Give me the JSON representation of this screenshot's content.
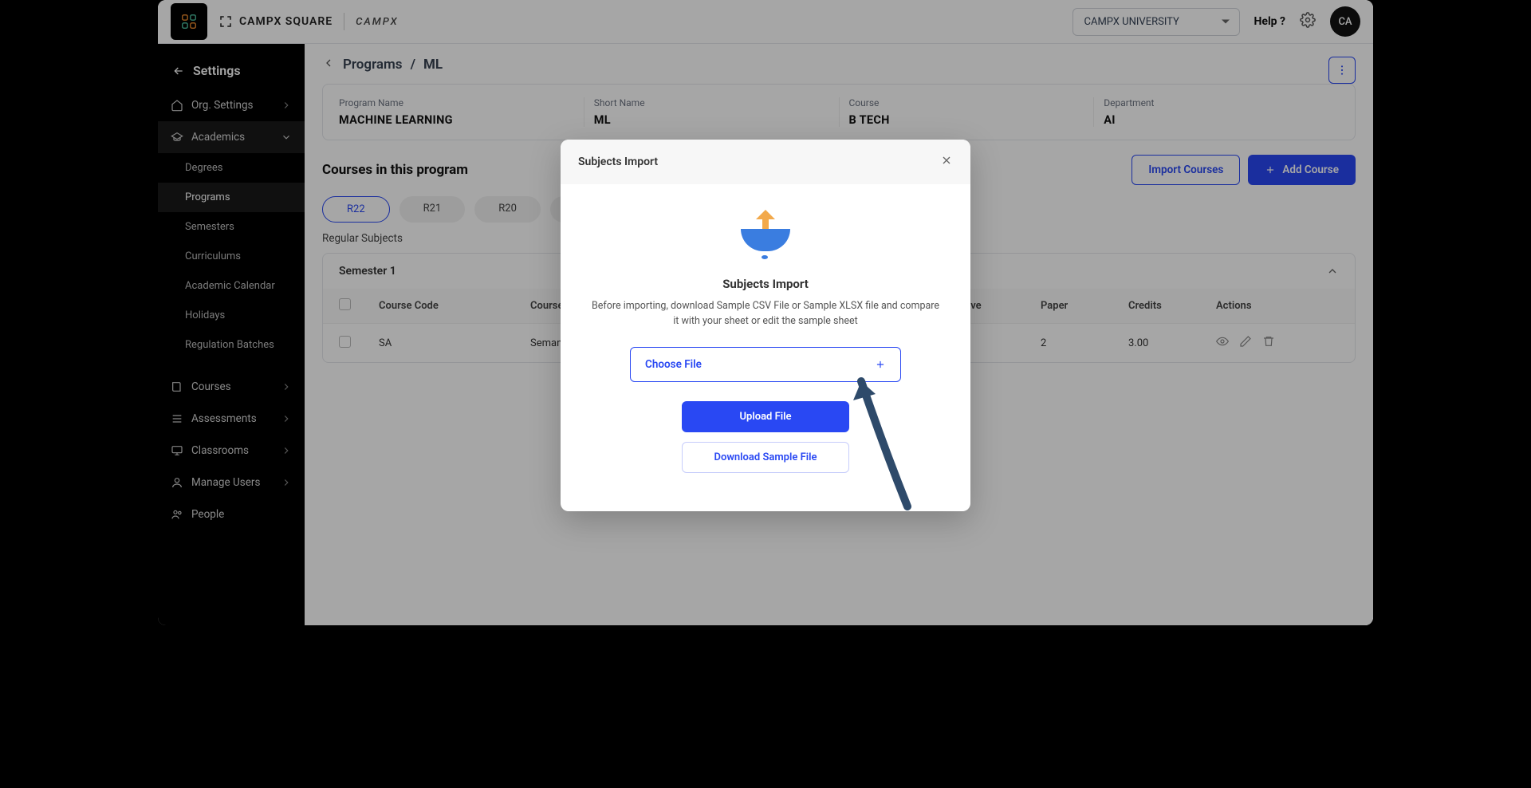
{
  "topbar": {
    "brand_square": "CAMPX SQUARE",
    "brand_x": "CAMPX",
    "university": "CAMPX UNIVERSITY",
    "help": "Help ?",
    "avatar": "CA"
  },
  "sidebar": {
    "header": "Settings",
    "groups": [
      {
        "label": "Org. Settings",
        "expandable": true
      },
      {
        "label": "Academics",
        "expandable": true,
        "expanded": true,
        "subs": [
          "Degrees",
          "Programs",
          "Semesters",
          "Curriculums",
          "Academic Calendar",
          "Holidays",
          "Regulation Batches"
        ],
        "active_sub": "Programs"
      },
      {
        "label": "Courses",
        "expandable": true
      },
      {
        "label": "Assessments",
        "expandable": true
      },
      {
        "label": "Classrooms",
        "expandable": true
      },
      {
        "label": "Manage Users",
        "expandable": true
      },
      {
        "label": "People",
        "expandable": false
      }
    ]
  },
  "crumbs": {
    "root": "Programs",
    "sep": "/",
    "current": "ML"
  },
  "details": [
    {
      "label": "Program Name",
      "value": "MACHINE LEARNING"
    },
    {
      "label": "Short Name",
      "value": "ML"
    },
    {
      "label": "Course",
      "value": "B TECH"
    },
    {
      "label": "Department",
      "value": "AI"
    }
  ],
  "section": {
    "title": "Courses in this program",
    "import_btn": "Import Courses",
    "add_btn": "Add Course"
  },
  "chips": [
    "R22",
    "R21",
    "R20"
  ],
  "active_chip": "R22",
  "subheader": "Regular Subjects",
  "semester": {
    "title": "Semester 1"
  },
  "table": {
    "headers": [
      "Course Code",
      "Course Name",
      "Elective",
      "Paper",
      "Credits",
      "Actions"
    ],
    "rows": [
      {
        "code": "SA",
        "name": "Seman",
        "paper": "2",
        "credits": "3.00"
      }
    ]
  },
  "modal": {
    "title": "Subjects Import",
    "heading": "Subjects Import",
    "desc": "Before importing, download Sample CSV File or Sample XLSX file and compare it with your sheet or edit the sample sheet",
    "choose": "Choose File",
    "upload": "Upload File",
    "download": "Download Sample File"
  }
}
